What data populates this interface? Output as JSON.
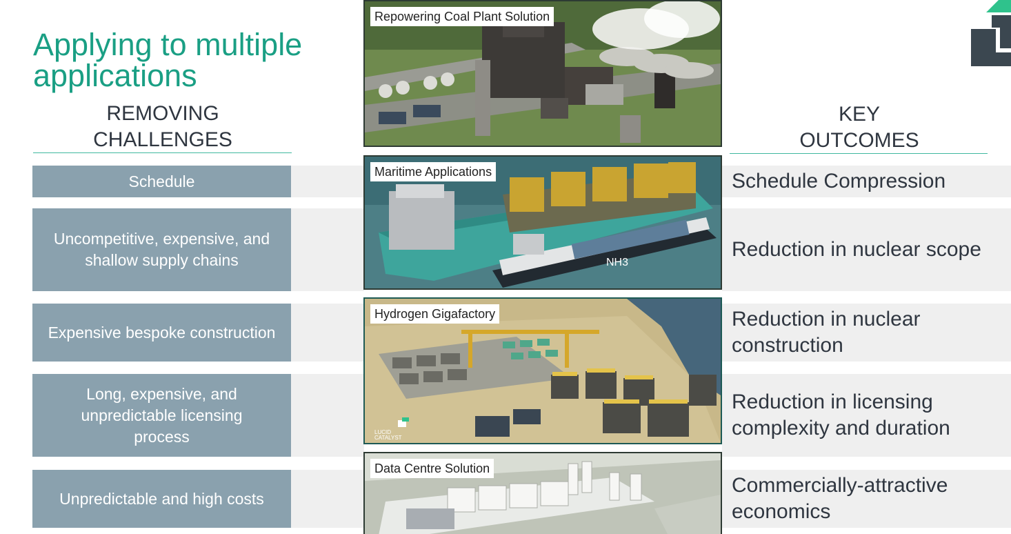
{
  "title": "Applying to multiple applications",
  "left_heading": {
    "line1": "REMOVING",
    "line2": "CHALLENGES"
  },
  "right_heading": {
    "line1": "KEY",
    "line2": "OUTCOMES"
  },
  "challenges": [
    {
      "text": "Schedule"
    },
    {
      "text": "Uncompetitive, expensive, and shallow supply chains"
    },
    {
      "text": "Expensive bespoke construction"
    },
    {
      "text": "Long, expensive, and unpredictable licensing process"
    },
    {
      "text": "Unpredictable and high costs"
    }
  ],
  "outcomes": [
    {
      "text": "Schedule Compression"
    },
    {
      "text": "Reduction in nuclear scope"
    },
    {
      "text": "Reduction in nuclear construction"
    },
    {
      "text": "Reduction in licensing complexity and duration"
    },
    {
      "text": "Commercially-attractive economics"
    }
  ],
  "applications": [
    {
      "label": "Repowering Coal Plant Solution"
    },
    {
      "label": "Maritime Applications",
      "ship_marking": "NH3"
    },
    {
      "label": "Hydrogen Gigafactory",
      "watermark_line1": "LUCID",
      "watermark_line2": "CATALYST"
    },
    {
      "label": "Data Centre Solution"
    }
  ],
  "colors": {
    "accent": "#1a9f84",
    "challenge_box": "#8aa1ae",
    "row_background": "#efefef",
    "text_dark": "#2f3640",
    "logo_dark": "#3b4750",
    "logo_green": "#2fc28c"
  },
  "icons": [
    "company-logo-icon"
  ]
}
